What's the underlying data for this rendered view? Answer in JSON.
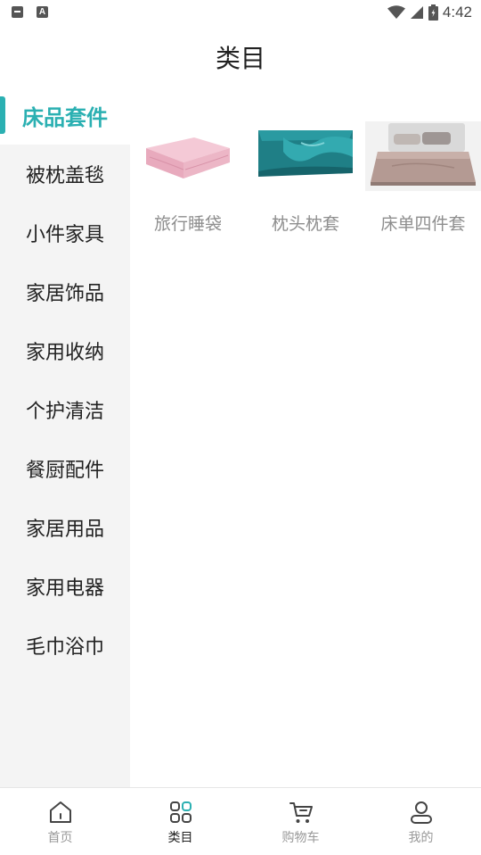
{
  "status_bar": {
    "time": "4:42",
    "notification_a": "A"
  },
  "header": {
    "title": "类目"
  },
  "sidebar": {
    "items": [
      {
        "label": "床品套件",
        "active": true
      },
      {
        "label": "被枕盖毯"
      },
      {
        "label": "小件家具"
      },
      {
        "label": "家居饰品"
      },
      {
        "label": "家用收纳"
      },
      {
        "label": "个护清洁"
      },
      {
        "label": "餐厨配件"
      },
      {
        "label": "家居用品"
      },
      {
        "label": "家用电器"
      },
      {
        "label": "毛巾浴巾"
      }
    ]
  },
  "products": [
    {
      "label": "旅行睡袋",
      "icon": "pink-sleeping-bag-image"
    },
    {
      "label": "枕头枕套",
      "icon": "teal-silk-pillowcase-image"
    },
    {
      "label": "床单四件套",
      "icon": "bedding-set-image"
    }
  ],
  "tabs": [
    {
      "label": "首页",
      "icon": "home-icon"
    },
    {
      "label": "类目",
      "icon": "category-icon",
      "active": true
    },
    {
      "label": "购物车",
      "icon": "cart-icon"
    },
    {
      "label": "我的",
      "icon": "user-icon"
    }
  ],
  "colors": {
    "accent": "#2bb0b2",
    "sidebar_bg": "#f4f4f4",
    "muted_text": "#8e8e8e"
  }
}
